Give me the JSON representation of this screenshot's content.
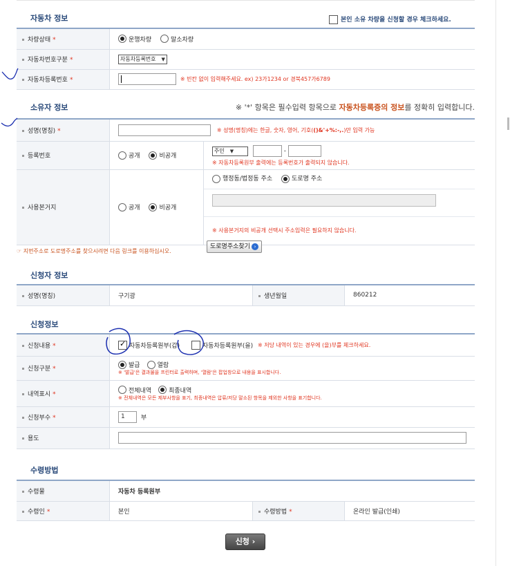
{
  "vehicle": {
    "title": "자동차 정보",
    "owner_check_label": "본인 소유 차량을 신청할 경우 체크하세요.",
    "rows": {
      "status_label": "차량상태",
      "status_opt1": "운행차량",
      "status_opt2": "말소차량",
      "plate_type_label": "자동차번호구분",
      "plate_type_value": "자동차등록번호",
      "plate_no_label": "자동차등록번호",
      "plate_no_hint": "※ 빈칸 없이 입력해주세요. ex) 23가1234 or 경북457가6789"
    }
  },
  "owner": {
    "title": "소유자 정보",
    "notice_prefix": "※ '*' 항목은 필수입력 항목으로 ",
    "notice_bold": "자동차등록증의 정보",
    "notice_suffix": "를 정확히 입력합니다.",
    "name_label": "성명(명칭)",
    "name_hint_a": "※ 성명(명칭)에는 한글, 숫자, 영어, 기호(",
    "name_hint_sym": "()&'+%:-,.",
    "name_hint_b": ")만 입력 가능",
    "regno_label": "등록번호",
    "public_label": "공개",
    "private_label": "비공개",
    "regno_type": "주민",
    "regno_note": "※ 자동차등록원부 출력에는 등록번호가 출력되지 않습니다.",
    "addr_label": "사용본거지",
    "addr_opt1": "행정동/법정동 주소",
    "addr_opt2": "도로명 주소",
    "addr_note": "※ 사용본거지의 비공개 선택시 주소입력은 필요하지 않습니다.",
    "road_link_text": "☞ 지번주소로 도로명주소를 찾으시려면 다음 링크를 이용하십시오.",
    "road_btn": "도로명주소찾기"
  },
  "applicant": {
    "title": "신청자 정보",
    "name_label": "성명(명칭)",
    "name_value": "구기광",
    "birth_label": "생년월일",
    "birth_value": "860212"
  },
  "request": {
    "title": "신청정보",
    "content_label": "신청내용",
    "content_opt1": "자동차등록원부(갑)",
    "content_opt2": "자동차등록원부(을)",
    "content_note": "※ 저당 내역이 있는 경우에 (을)부를 체크하세요.",
    "kind_label": "신청구분",
    "kind_opt1": "발급",
    "kind_opt2": "열람",
    "kind_note": "※ '발급'은 결과물을 프린터로 출력하며, '열람'은 팝업창으로 내용을 표시합니다.",
    "display_label": "내역표시",
    "display_opt1": "전체내역",
    "display_opt2": "최종내역",
    "display_note": "※ 전체내역은 모든 제부사항을 표기, 최종내역은 압류/저당 말소된 항목을 제외한 사항을 표기합니다.",
    "copies_label": "신청부수",
    "copies_value": "1",
    "copies_unit": "부",
    "purpose_label": "용도"
  },
  "receipt": {
    "title": "수령방법",
    "doc_label": "수령물",
    "doc_value": "자동차 등록원부",
    "who_label": "수령인",
    "who_value": "본인",
    "method_label": "수령방법",
    "method_value": "온라인 발급(인쇄)"
  },
  "submit_label": "신청 ›",
  "colors": {
    "header_line": "#8ea6c7",
    "required": "#e0341f",
    "title": "#2a4a7a"
  }
}
